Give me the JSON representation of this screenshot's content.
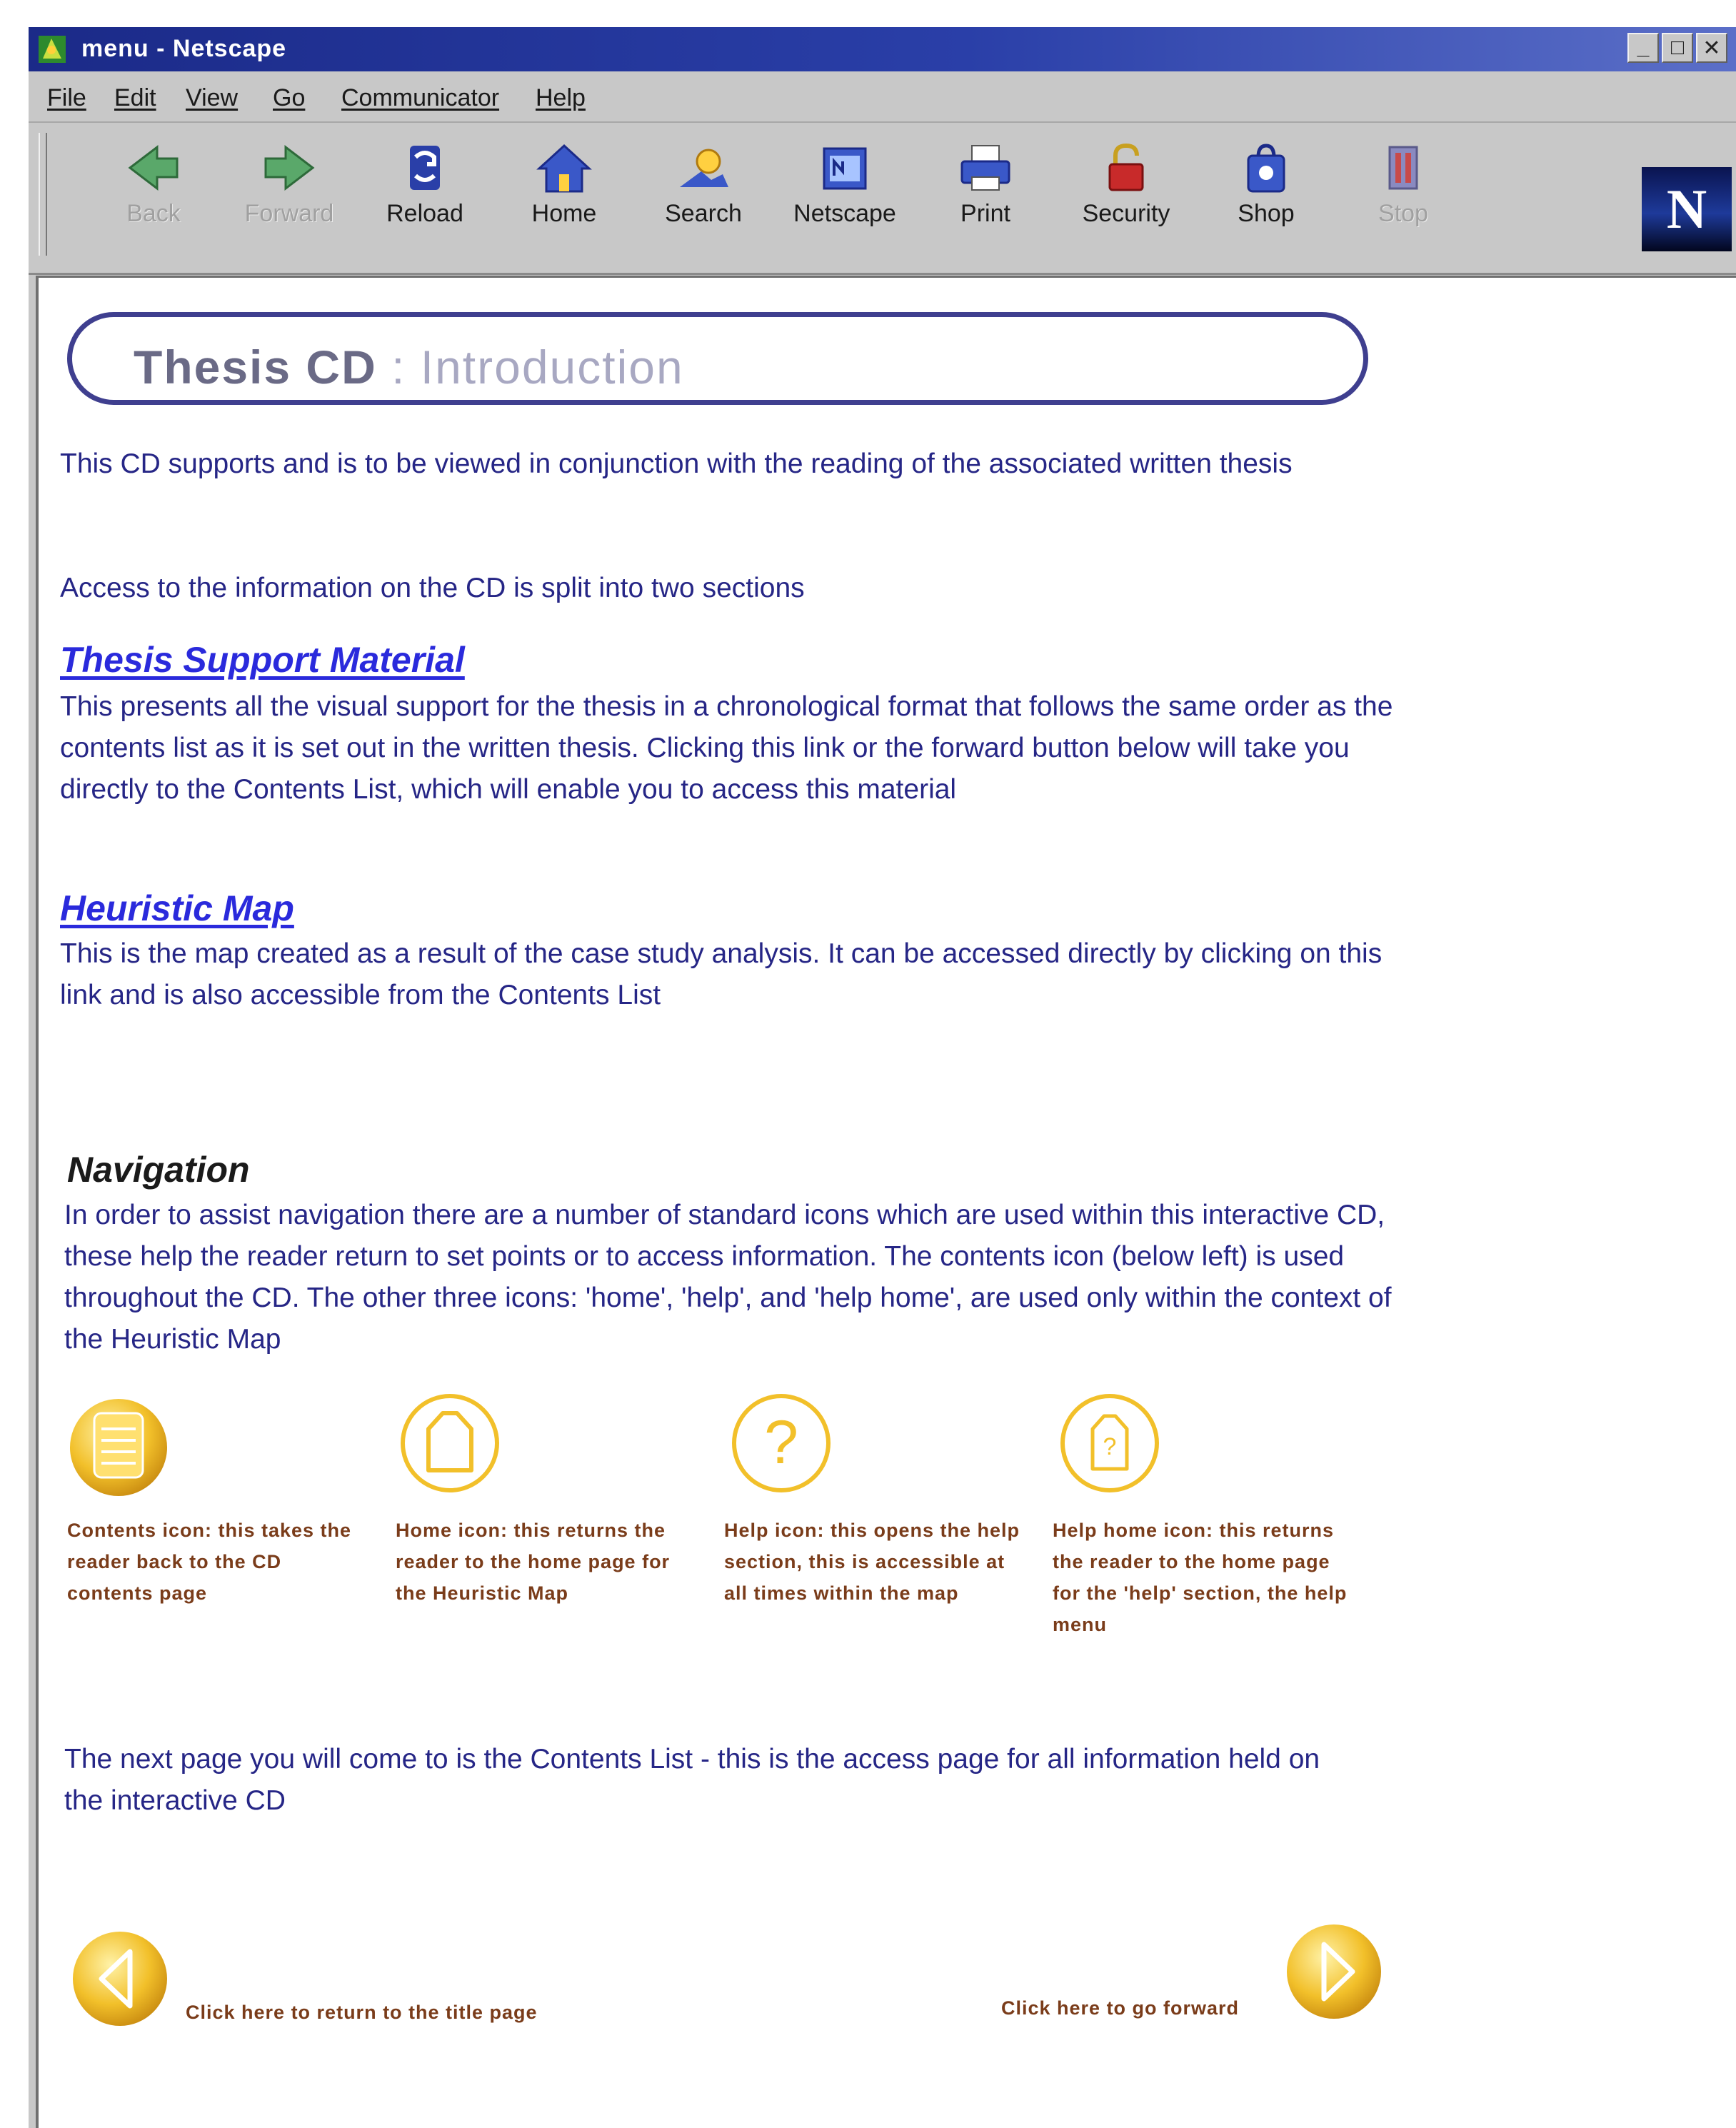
{
  "window": {
    "title": "menu - Netscape",
    "controls": [
      "minimize",
      "maximize",
      "close"
    ]
  },
  "menu": [
    "File",
    "Edit",
    "View",
    "Go",
    "Communicator",
    "Help"
  ],
  "toolbar": {
    "back": "Back",
    "forward": "Forward",
    "reload": "Reload",
    "home": "Home",
    "search": "Search",
    "netscape": "Netscape",
    "print": "Print",
    "security": "Security",
    "shop": "Shop",
    "stop": "Stop"
  },
  "page": {
    "title_main": "Thesis CD",
    "title_sep": " : ",
    "title_sub": "Introduction",
    "intro_1": "This CD supports and is to be viewed in conjunction with the reading of the associated written thesis",
    "intro_2": "Access to the information on the CD is split into two sections",
    "link_1": "Thesis Support Material",
    "link_1_desc": "This presents all the visual support for the thesis in a chronological format that follows the same order as the contents list as it is set out in the written thesis. Clicking this link or the forward button below will take you directly to the Contents List, which will enable you to access this material",
    "link_2": "Heuristic Map",
    "link_2_desc": "This is the map created as a result of the case study analysis. It can be accessed directly by clicking on this link and is also accessible from the Contents List",
    "nav_heading": "Navigation",
    "nav_desc": "In order to assist navigation there are a number of standard icons which are used within this interactive CD, these help the reader return to set points or to access information. The contents icon (below left) is used throughout the CD. The other three icons: 'home', 'help', and 'help home', are used only within the context of the Heuristic Map",
    "icons": [
      {
        "icon": "contents-icon",
        "caption": "Contents icon: this takes the reader back to the CD contents page"
      },
      {
        "icon": "home-icon",
        "caption": "Home icon: this returns the reader to the home page for the Heuristic Map"
      },
      {
        "icon": "help-icon",
        "caption": "Help icon: this opens the help section, this is accessible at all times within the map"
      },
      {
        "icon": "help-home-icon",
        "caption": "Help home icon: this returns the reader to the home page for the 'help' section, the help menu"
      }
    ],
    "next_page": "The next page you will come to is the Contents List - this is the access page for all information held on the interactive CD",
    "back_caption": "Click here to return to the title page",
    "forward_caption": "Click here to go forward"
  },
  "colors": {
    "title_bar": "#1b2a88",
    "body_text": "#262686",
    "link": "#2a2adc",
    "icon_gold": "#f2c02a"
  }
}
